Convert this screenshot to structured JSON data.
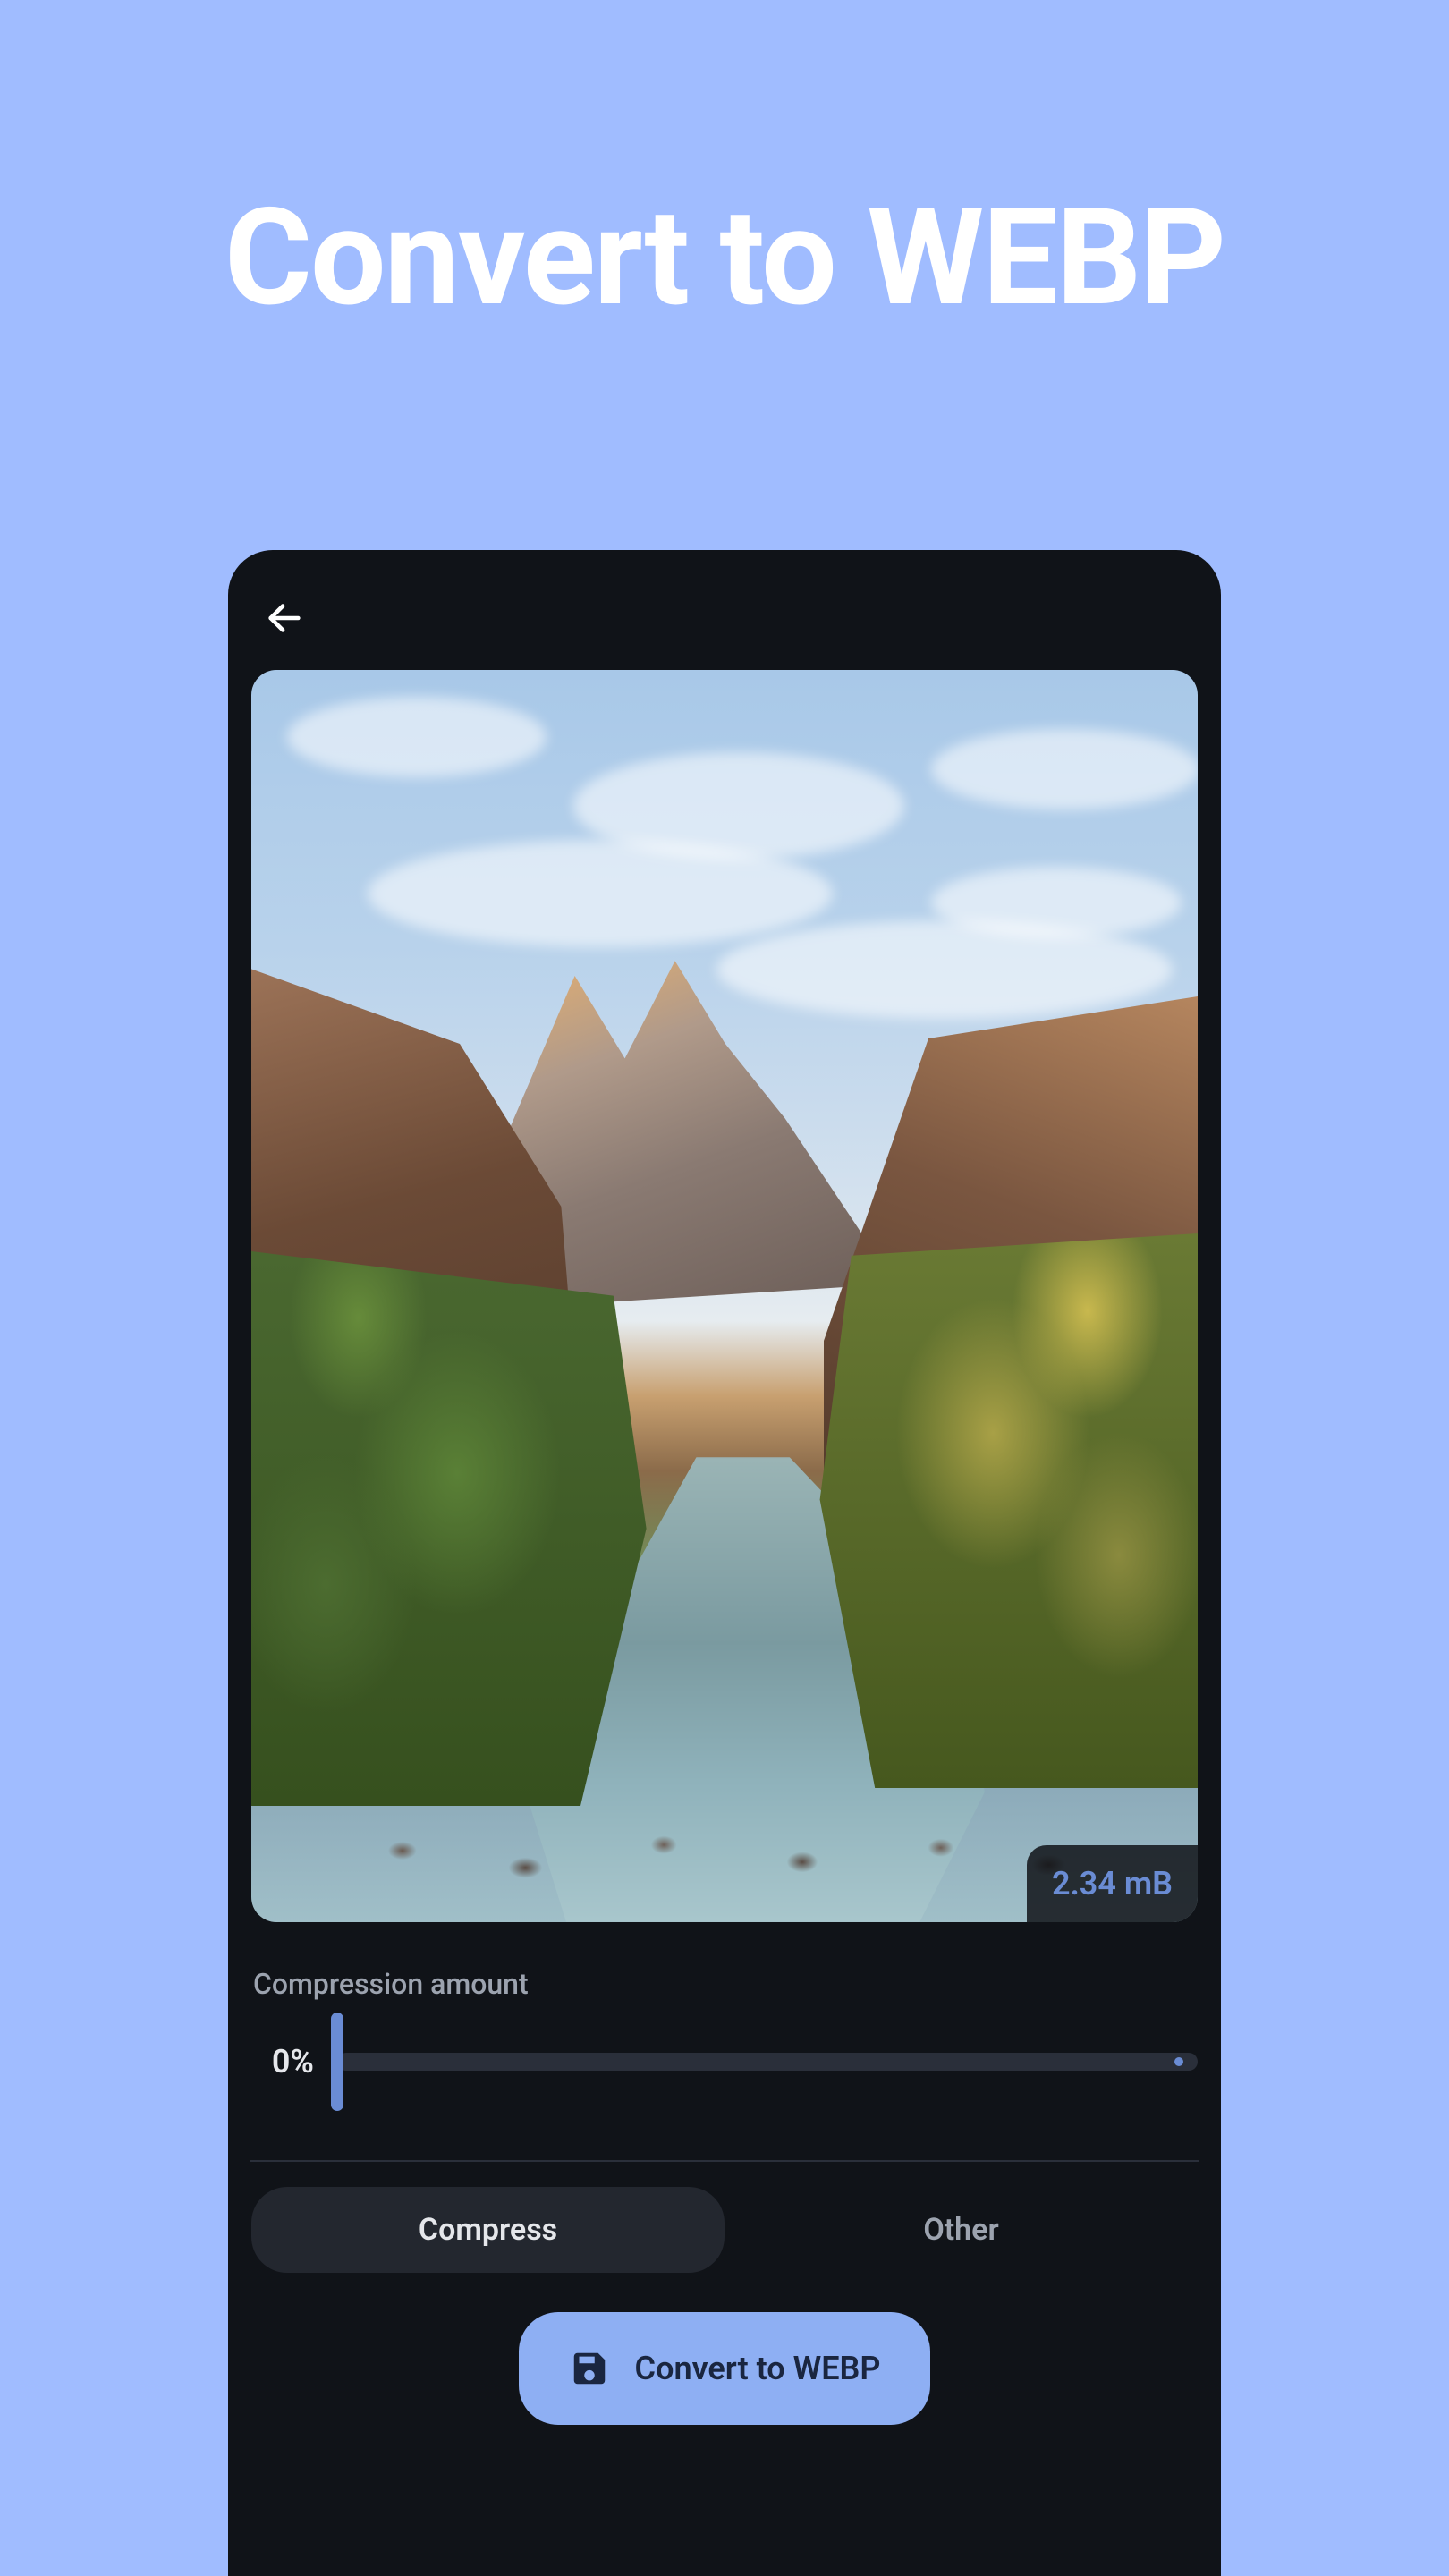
{
  "page": {
    "title": "Convert to WEBP"
  },
  "preview": {
    "file_size": "2.34 mB"
  },
  "compression": {
    "label": "Compression amount",
    "value_display": "0%"
  },
  "tabs": {
    "compress": "Compress",
    "other": "Other"
  },
  "cta": {
    "label": "Convert to WEBP"
  },
  "colors": {
    "accent": "#8eaff3",
    "bg": "#a0bcff",
    "frame": "#101318"
  }
}
